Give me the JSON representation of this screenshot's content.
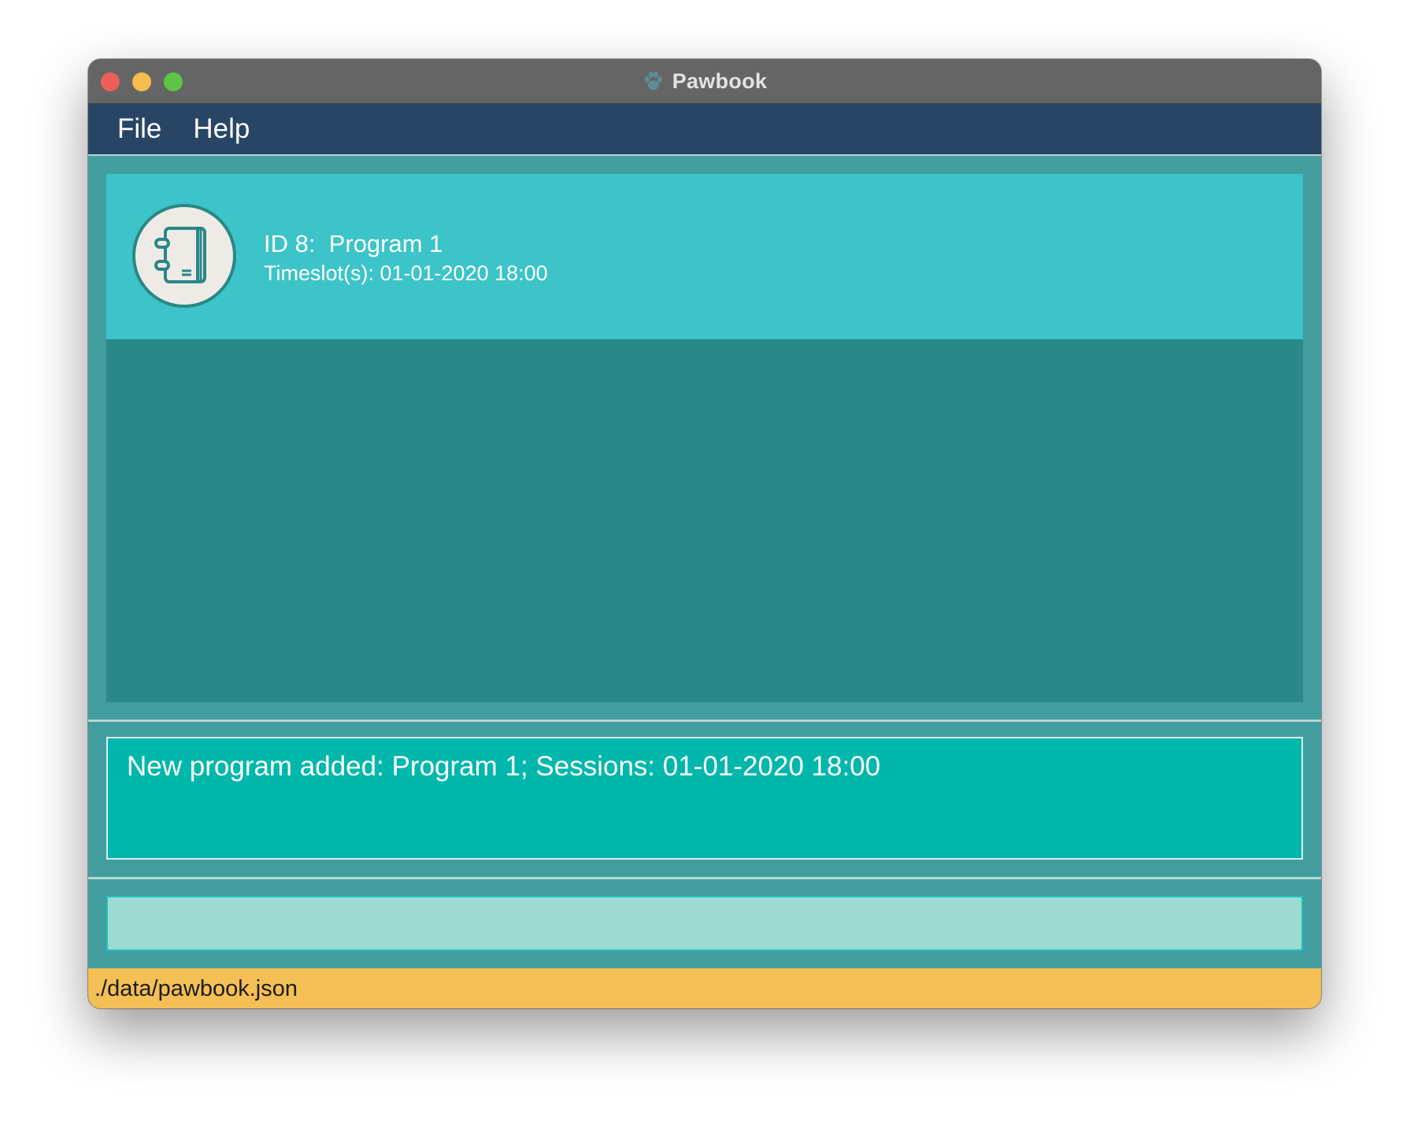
{
  "window": {
    "title": "Pawbook",
    "title_icon": "paw-icon"
  },
  "menubar": {
    "items": [
      {
        "label": "File"
      },
      {
        "label": "Help"
      }
    ]
  },
  "program_list": {
    "items": [
      {
        "icon": "notebook-icon",
        "title": "ID 8:  Program 1",
        "timeslot": "Timeslot(s): 01-01-2020 18:00"
      }
    ]
  },
  "result_display": {
    "text": "New program added: Program 1; Sessions: 01-01-2020 18:00"
  },
  "command_box": {
    "value": "",
    "placeholder": ""
  },
  "status_bar": {
    "path": "./data/pawbook.json"
  },
  "colors": {
    "menubar": "#284566",
    "card": "#3cc4c8",
    "list_background": "#298888",
    "result_background": "#00b7ab",
    "command_background": "#9ddad1",
    "status_bar": "#f4bf55"
  }
}
